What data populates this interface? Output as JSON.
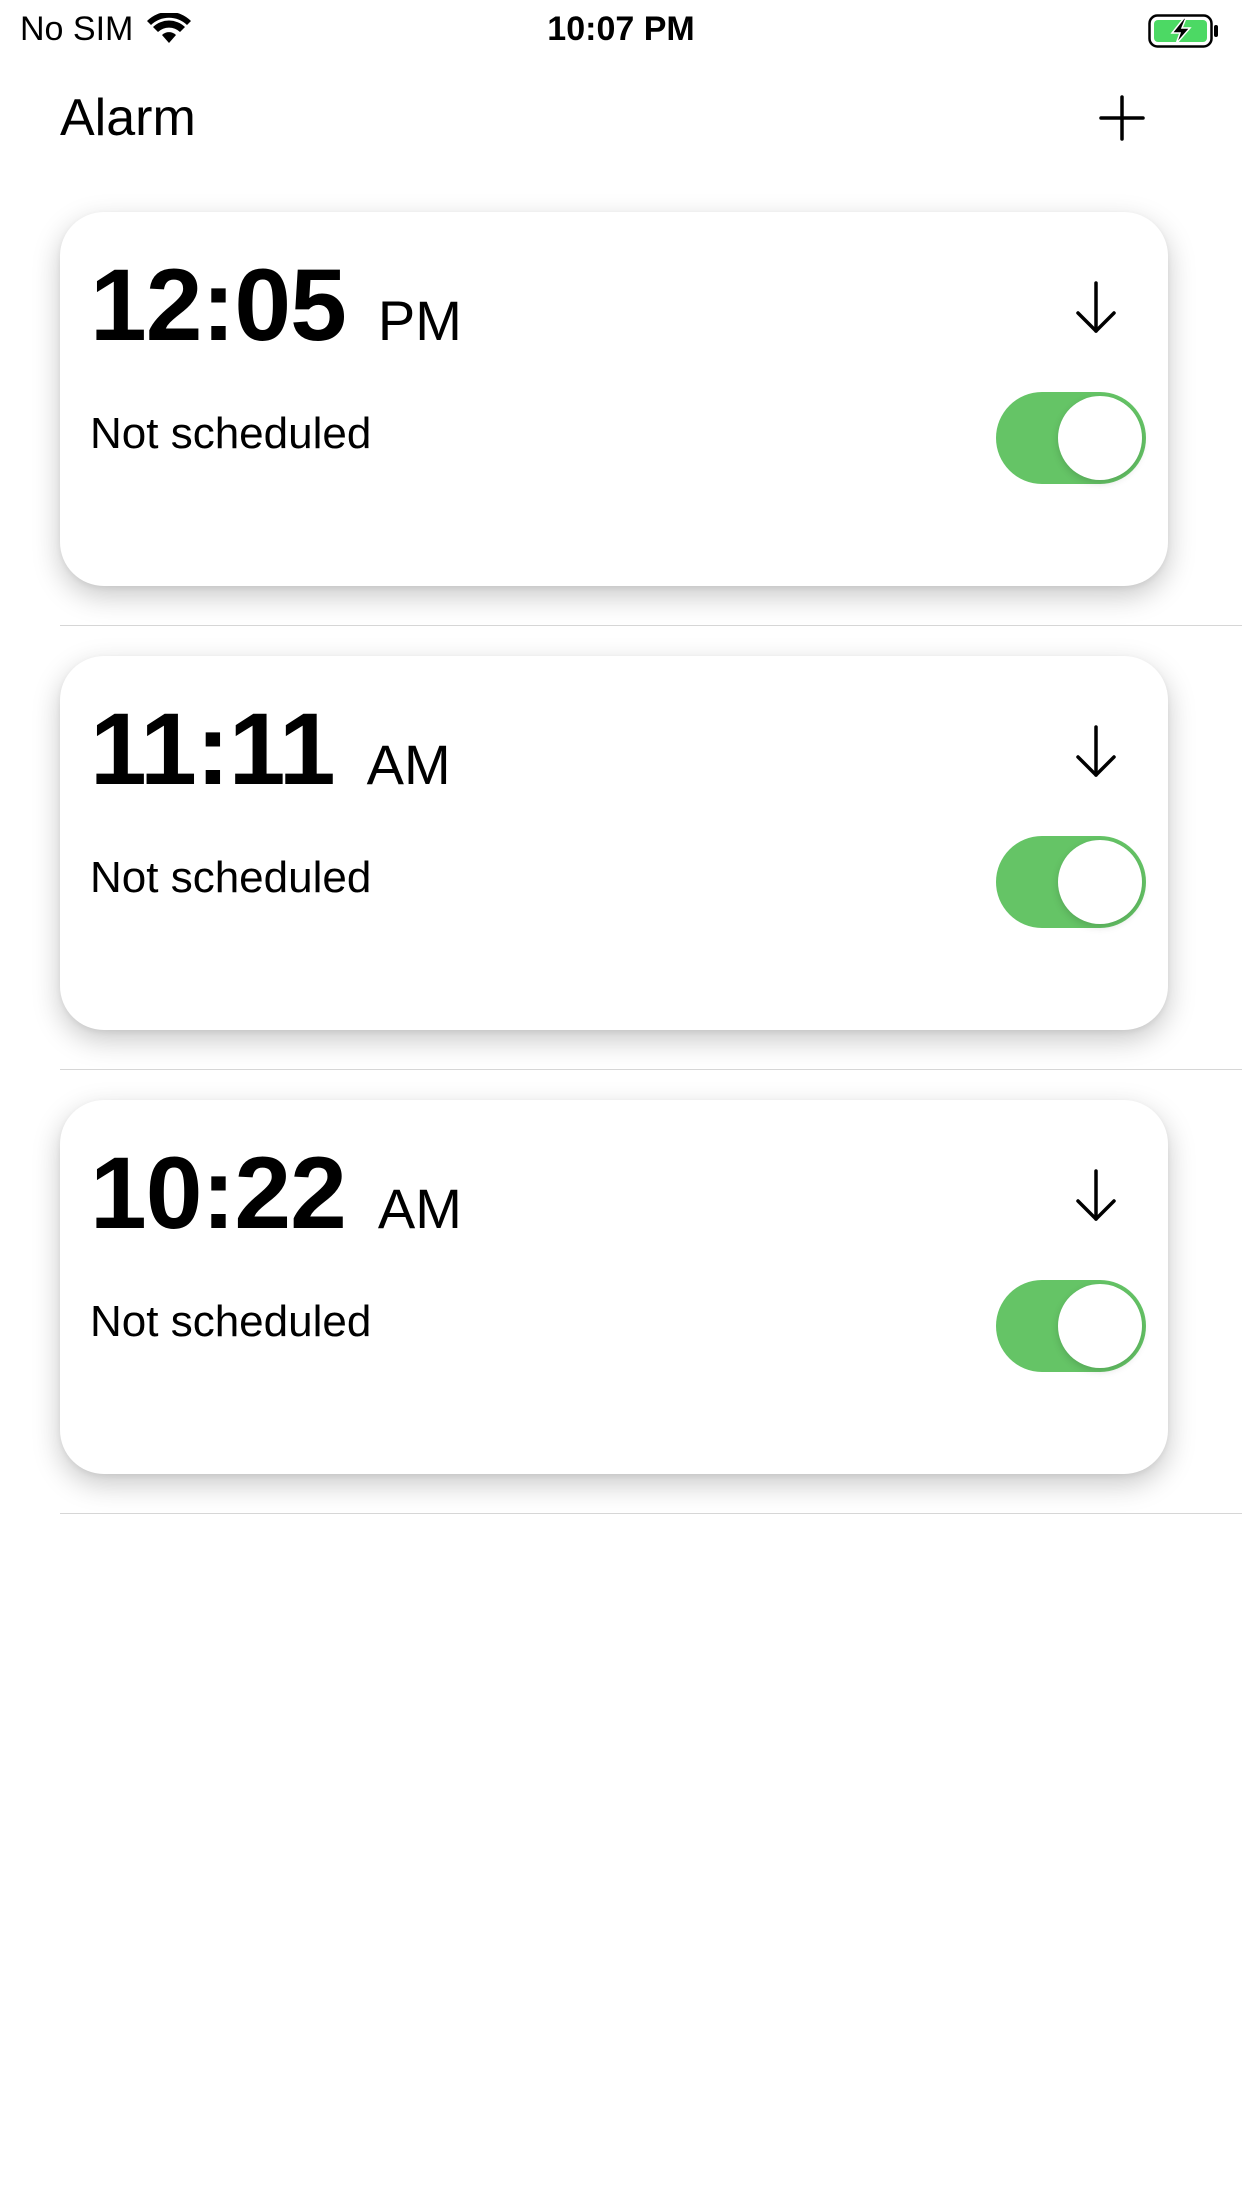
{
  "status_bar": {
    "carrier": "No SIM",
    "time": "10:07 PM",
    "wifi_icon": "wifi-icon",
    "battery_icon": "battery-charging-icon",
    "battery_color": "#4cd964"
  },
  "nav": {
    "title": "Alarm",
    "add_icon": "plus-icon"
  },
  "accent_color": "#65c466",
  "alarms": [
    {
      "time": "12:05",
      "period": "PM",
      "schedule": "Not scheduled",
      "enabled": true,
      "expand_icon": "arrow-down-icon"
    },
    {
      "time": "11:11",
      "period": "AM",
      "schedule": "Not scheduled",
      "enabled": true,
      "expand_icon": "arrow-down-icon"
    },
    {
      "time": "10:22",
      "period": "AM",
      "schedule": "Not scheduled",
      "enabled": true,
      "expand_icon": "arrow-down-icon"
    }
  ]
}
